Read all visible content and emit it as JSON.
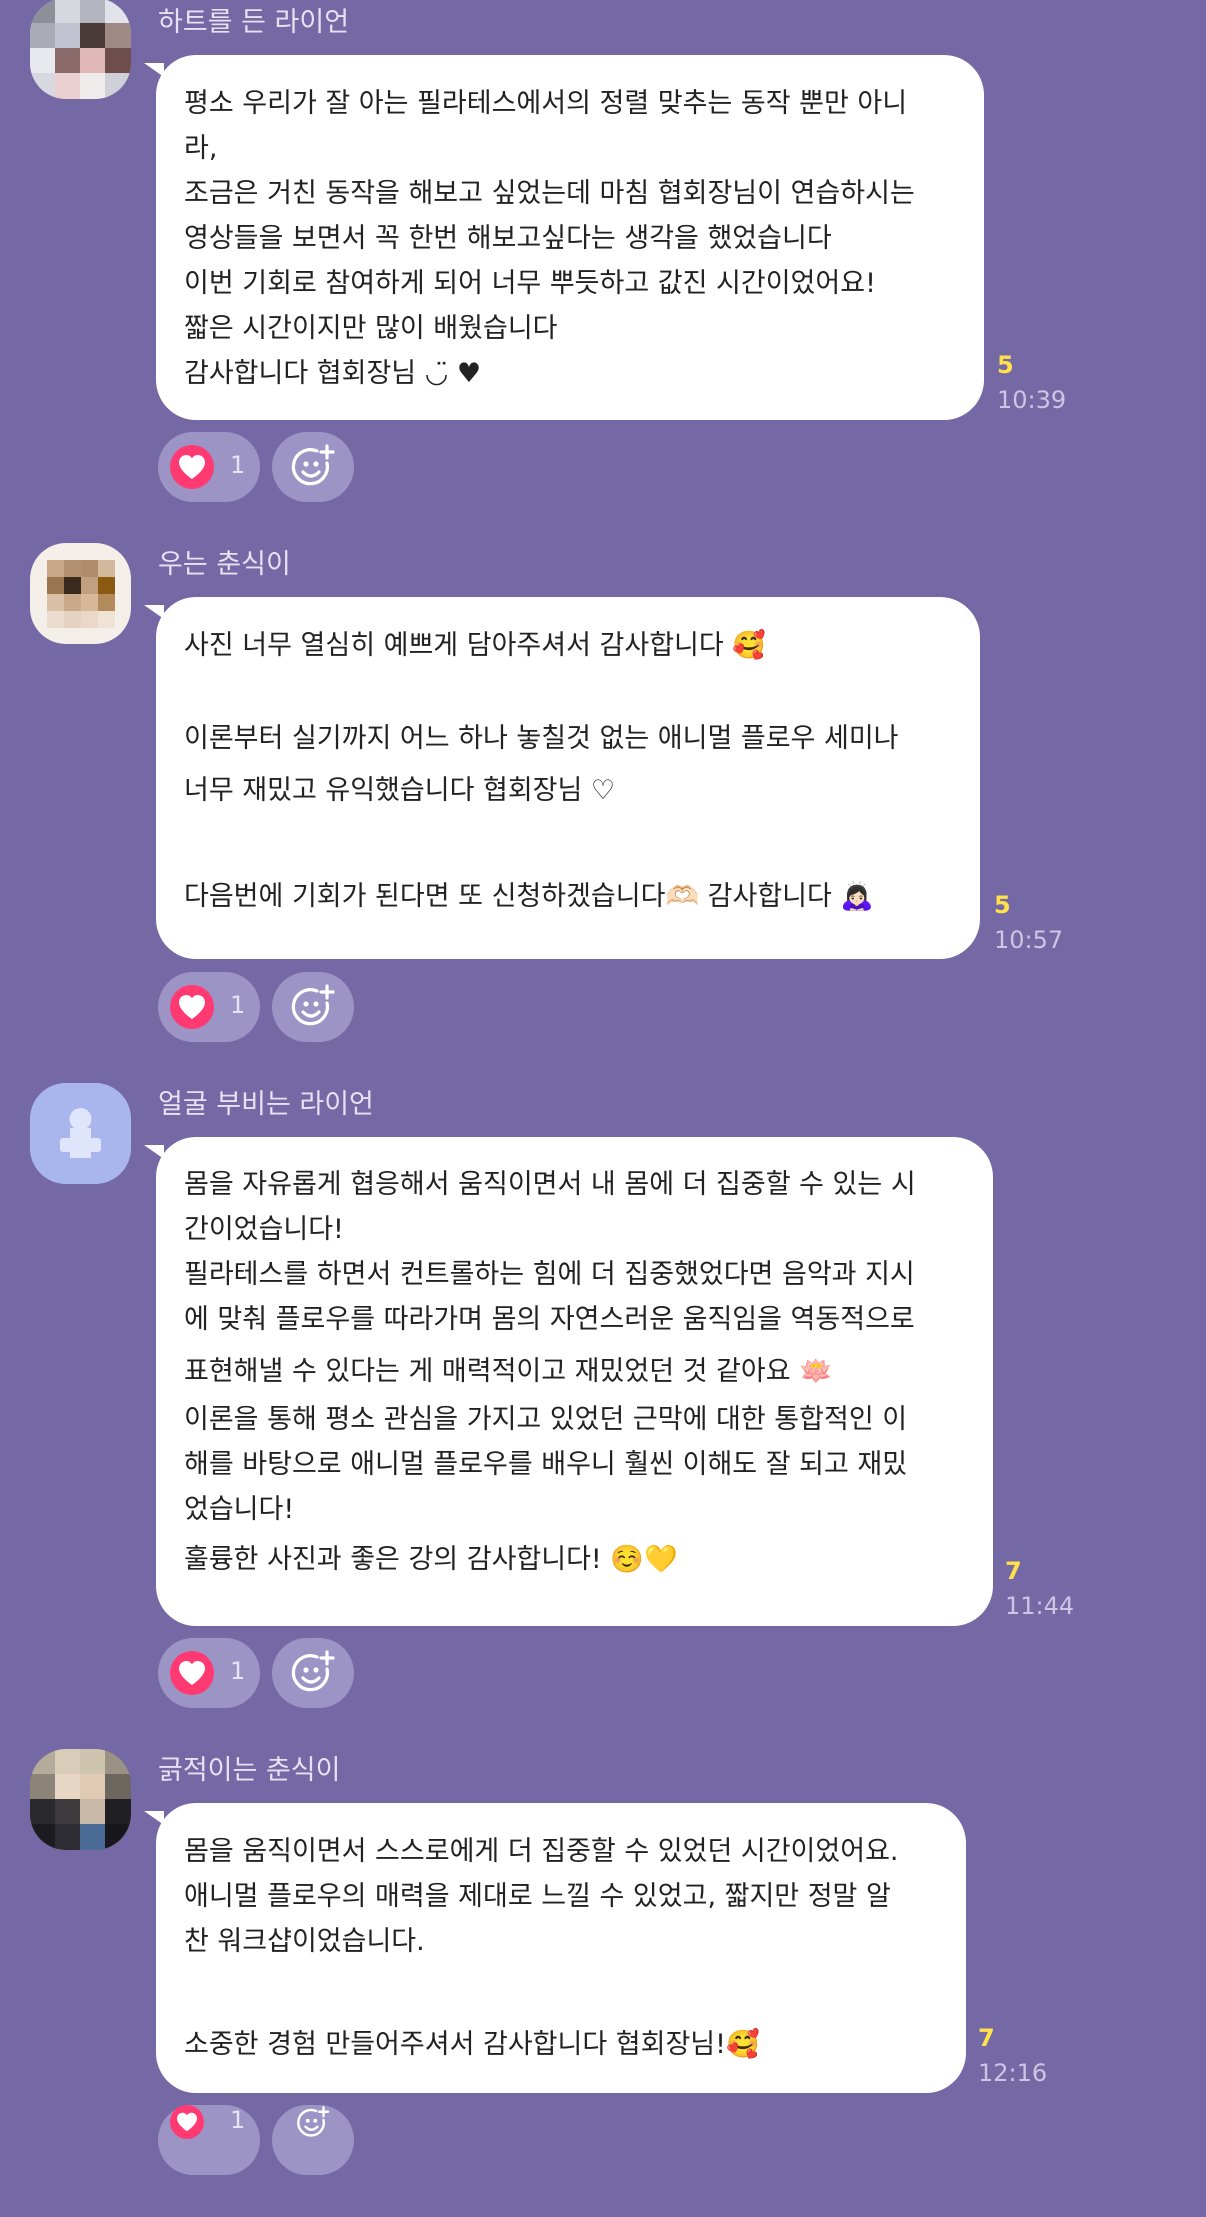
{
  "messages": [
    {
      "sender": "하트를 든 라이언",
      "lines": [
        "평소 우리가 잘 아는 필라테스에서의 정렬 맞추는 동작 뿐만 아니",
        "라,",
        "조금은 거친 동작을 해보고 싶었는데 마침 협회장님이 연습하시는",
        "영상들을 보면서 꼭 한번 해보고싶다는 생각을 했었습니다",
        "이번 기회로 참여하게 되어 너무 뿌듯하고 값진 시간이었어요!",
        "짧은 시간이지만 많이 배웠습니다",
        "감사합니다 협회장님 ◡̈ ♥"
      ],
      "unread": "5",
      "time": "10:39",
      "likes": "1"
    },
    {
      "sender": "우는 춘식이",
      "lines": [
        "사진 너무 열심히 예쁘게 담아주셔서 감사합니다 🥰",
        "",
        "이론부터 실기까지 어느 하나 놓칠것 없는 애니멀 플로우 세미나",
        "너무 재밌고 유익했습니다 협회장님 ♡",
        "",
        "다음번에 기회가 된다면 또 신청하겠습니다🫶🏻 감사합니다 🙇🏻‍♀️"
      ],
      "unread": "5",
      "time": "10:57",
      "likes": "1"
    },
    {
      "sender": "얼굴 부비는 라이언",
      "lines": [
        "몸을 자유롭게 협응해서 움직이면서 내 몸에 더 집중할 수 있는 시",
        "간이었습니다!",
        "필라테스를 하면서 컨트롤하는 힘에 더 집중했었다면 음악과 지시",
        "에 맞춰 플로우를 따라가며 몸의 자연스러운 움직임을 역동적으로",
        "표현해낼 수 있다는 게 매력적이고 재밌었던 것 같아요 🪷",
        "이론을 통해 평소 관심을 가지고 있었던 근막에 대한 통합적인 이",
        "해를 바탕으로 애니멀 플로우를 배우니 훨씬 이해도 잘 되고 재밌",
        "었습니다!",
        "훌륭한 사진과 좋은 강의 감사합니다! ☺️💛"
      ],
      "unread": "7",
      "time": "11:44",
      "likes": "1"
    },
    {
      "sender": "긁적이는 춘식이",
      "lines": [
        "몸을 움직이면서 스스로에게 더 집중할 수 있었던 시간이었어요.",
        "애니멀 플로우의 매력을 제대로 느낄 수 있었고, 짧지만 정말 알",
        "찬 워크샵이었습니다.",
        "",
        "소중한 경험 만들어주셔서 감사합니다 협회장님!🥰"
      ],
      "unread": "7",
      "time": "12:16",
      "likes": "1"
    }
  ],
  "icons": {
    "like": "heart-icon",
    "add_reaction": "add-reaction-smile-icon"
  },
  "colors": {
    "background": "#7468a5",
    "bubble": "#ffffff",
    "unread": "#ffe14a",
    "heart": "#ff3a72",
    "reaction_pill": "#9d94c6"
  }
}
